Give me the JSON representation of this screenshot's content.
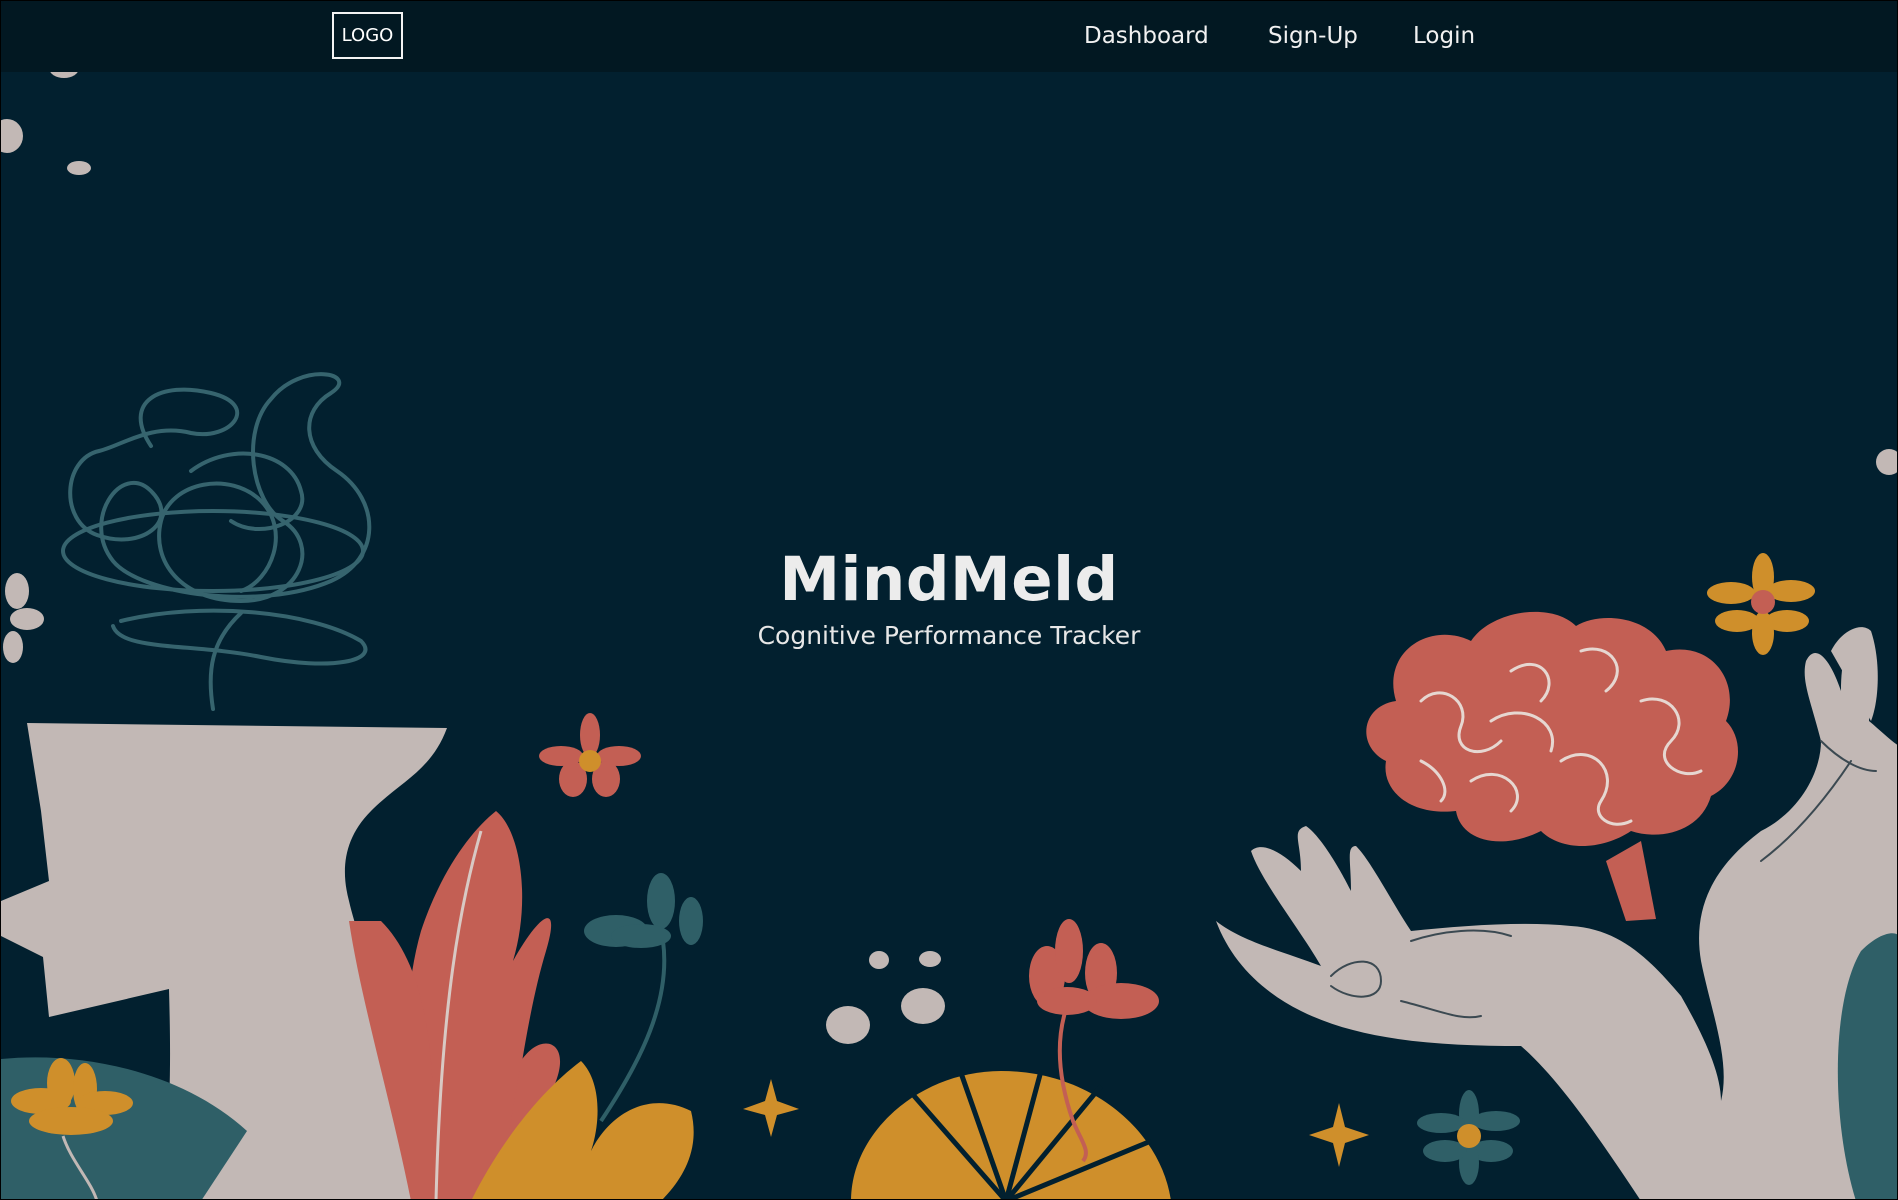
{
  "header": {
    "logo": "LOGO",
    "nav": [
      {
        "label": "Dashboard"
      },
      {
        "label": "Sign-Up"
      },
      {
        "label": "Login"
      }
    ]
  },
  "hero": {
    "title": "MindMeld",
    "subtitle": "Cognitive Performance Tracker"
  },
  "colors": {
    "background": "#02202f",
    "topbar": "#021822",
    "coral": "#c35f54",
    "mustard": "#cf8f2b",
    "teal": "#2f5f67",
    "stone": "#c2b8b5"
  },
  "illustration": {
    "icons": [
      "head-silhouette-icon",
      "tangled-thoughts-icon",
      "brain-icon",
      "hands-icon",
      "flower-icon",
      "leaf-icon",
      "sparkle-icon"
    ]
  }
}
